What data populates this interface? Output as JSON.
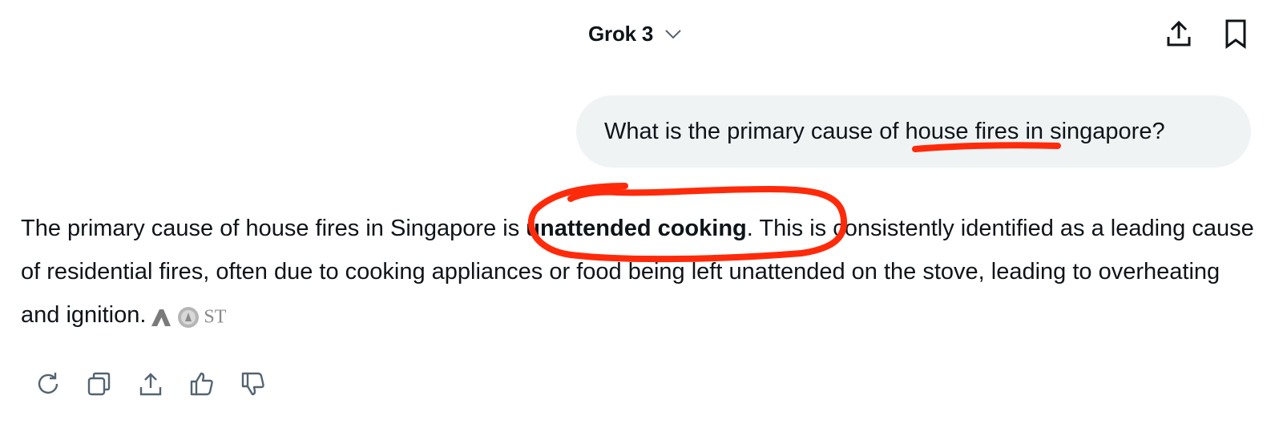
{
  "header": {
    "model_name": "Grok 3",
    "model_icon": "chevron-down-icon",
    "share_icon": "share-upload-icon",
    "bookmark_icon": "bookmark-icon"
  },
  "user_message": {
    "before": "What is the primary cause of ",
    "highlight": "house fires",
    "after": " in singapore?"
  },
  "answer": {
    "line_part1": "The primary cause of house fires in Singapore is ",
    "bold": "unattended cooking",
    "line_part2": ". This is consistently identified as a leading cause of residential fires, often due to cooking appliances or food being left unattended on the stove, leading to overheating and ",
    "last_word": "ignition.",
    "source_icons": [
      "source-icon-a",
      "source-icon-seal",
      "source-icon-st"
    ],
    "source_st_text": "ST"
  },
  "actions": [
    "regenerate-icon",
    "copy-icon",
    "share-icon",
    "thumbs-up-icon",
    "thumbs-down-icon"
  ],
  "colors": {
    "annotation": "#ff2a0a",
    "bubble": "#eff3f4",
    "icon": "#536471",
    "text": "#0f1419"
  }
}
